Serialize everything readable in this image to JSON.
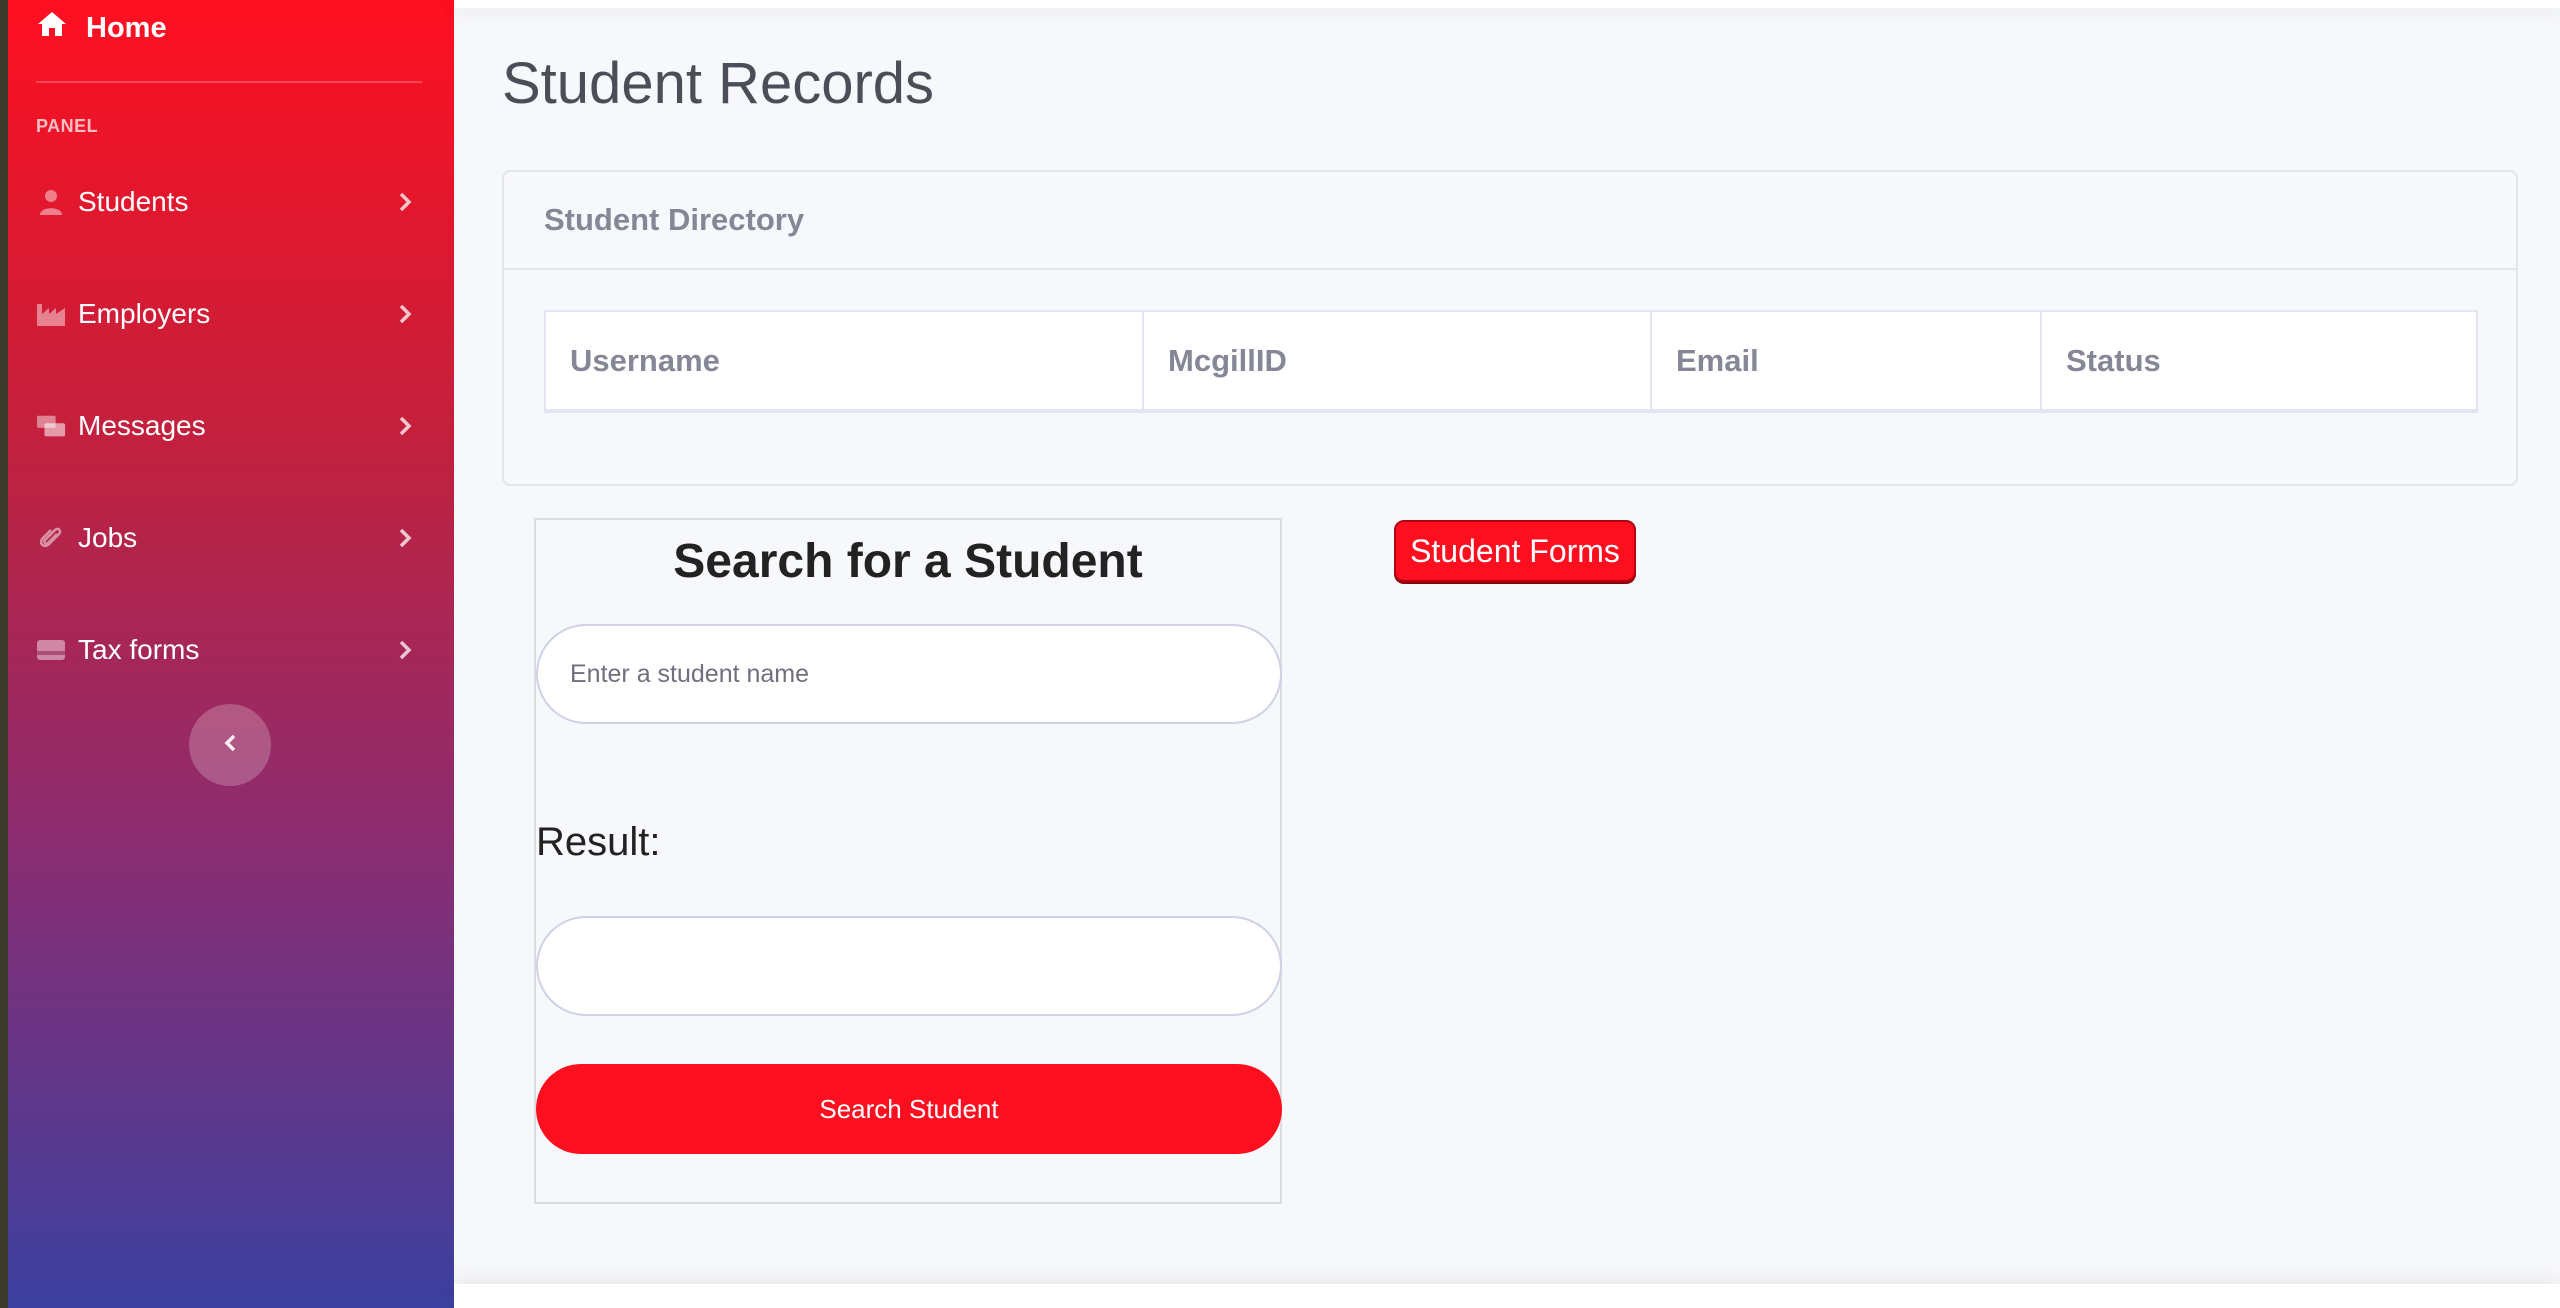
{
  "sidebar": {
    "home_label": "Home",
    "section_label": "PANEL",
    "items": [
      {
        "label": "Students",
        "icon": "user-icon"
      },
      {
        "label": "Employers",
        "icon": "factory-icon"
      },
      {
        "label": "Messages",
        "icon": "mail-stack-icon"
      },
      {
        "label": "Jobs",
        "icon": "paperclip-icon"
      },
      {
        "label": "Tax forms",
        "icon": "credit-card-icon"
      }
    ]
  },
  "main": {
    "page_title": "Student Records",
    "directory": {
      "title": "Student Directory",
      "columns": [
        "Username",
        "McgillID",
        "Email",
        "Status"
      ]
    },
    "search": {
      "title": "Search for a Student",
      "input_placeholder": "Enter a student name",
      "input_value": "",
      "result_label": "Result:",
      "result_value": "",
      "button_label": "Search Student"
    },
    "forms_button_label": "Student Forms"
  },
  "colors": {
    "accent": "#fe0f20",
    "sidebar_gradient_top": "#fe0f20",
    "sidebar_gradient_bottom": "#3b40a0",
    "muted_text": "#858796"
  }
}
